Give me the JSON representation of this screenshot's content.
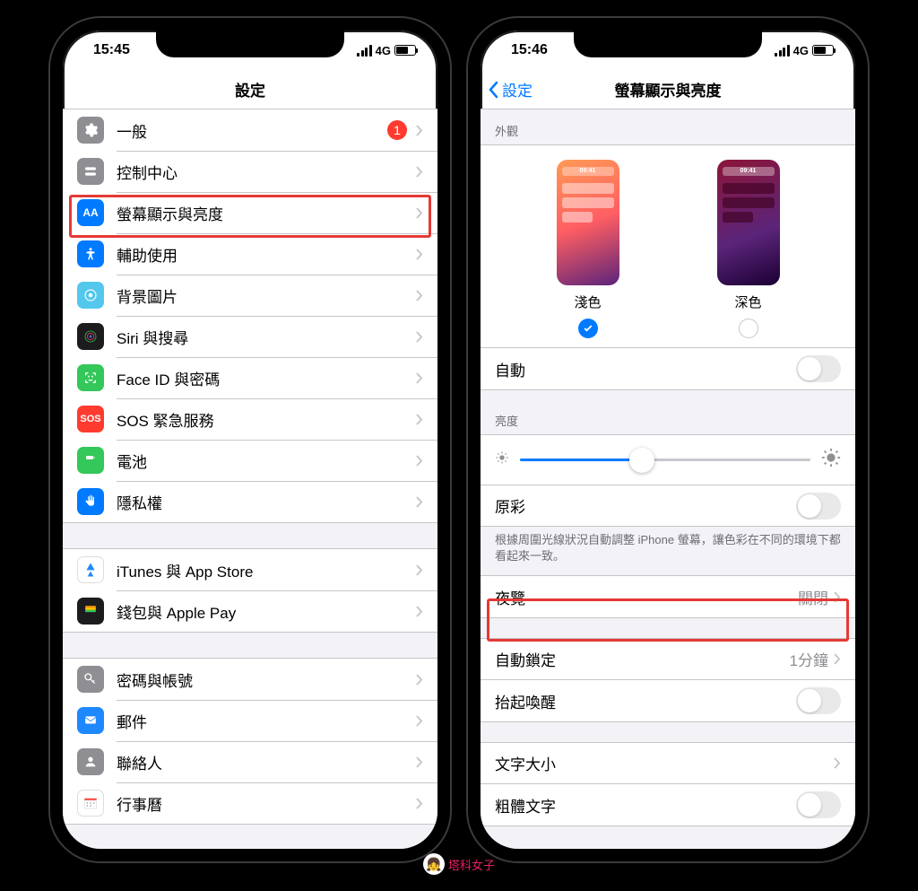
{
  "watermark": "塔科女子",
  "phone1": {
    "time": "15:45",
    "network": "4G",
    "title": "設定",
    "badge_general": "1",
    "rows": {
      "general": "一般",
      "control_center": "控制中心",
      "display": "螢幕顯示與亮度",
      "accessibility": "輔助使用",
      "wallpaper": "背景圖片",
      "siri": "Siri 與搜尋",
      "faceid": "Face ID 與密碼",
      "sos": "SOS 緊急服務",
      "battery": "電池",
      "privacy": "隱私權",
      "itunes": "iTunes 與 App Store",
      "wallet": "錢包與 Apple Pay",
      "passwords": "密碼與帳號",
      "mail": "郵件",
      "contacts": "聯絡人",
      "calendar": "行事曆"
    }
  },
  "phone2": {
    "time": "15:46",
    "network": "4G",
    "back": "設定",
    "title": "螢幕顯示與亮度",
    "section_appearance": "外觀",
    "light": "淺色",
    "dark": "深色",
    "auto": "自動",
    "section_brightness": "亮度",
    "true_tone": "原彩",
    "true_tone_desc": "根據周圍光線狀況自動調整 iPhone 螢幕，讓色彩在不同的環境下都看起來一致。",
    "night_shift": "夜覽",
    "night_shift_value": "關閉",
    "auto_lock": "自動鎖定",
    "auto_lock_value": "1分鐘",
    "raise_to_wake": "抬起喚醒",
    "text_size": "文字大小",
    "bold_text": "粗體文字"
  }
}
